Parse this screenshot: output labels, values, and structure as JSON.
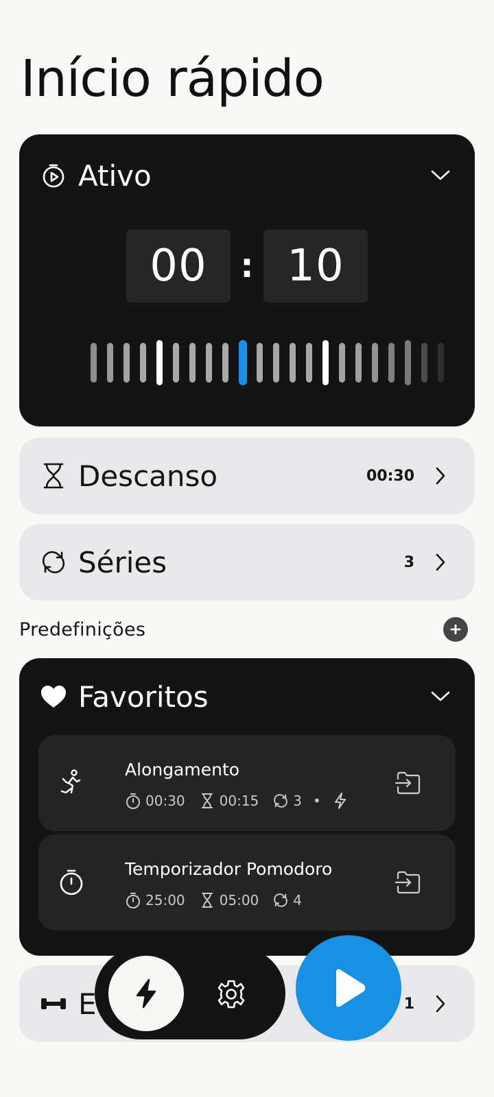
{
  "page": {
    "title": "Início rápido"
  },
  "active": {
    "label": "Ativo",
    "minutes": "00",
    "separator": ":",
    "seconds": "10"
  },
  "rest": {
    "label": "Descanso",
    "value": "00:30"
  },
  "sets": {
    "label": "Séries",
    "value": "3"
  },
  "presets_section": {
    "label": "Predefinições"
  },
  "favorites": {
    "label": "Favoritos",
    "items": [
      {
        "name": "Alongamento",
        "icon": "stretch-figure-icon",
        "work": "00:30",
        "rest": "00:15",
        "sets": "3",
        "dot": "•",
        "extra_icon": "lightning-icon"
      },
      {
        "name": "Temporizador Pomodoro",
        "icon": "stopwatch-icon",
        "work": "25:00",
        "rest": "05:00",
        "sets": "4"
      }
    ]
  },
  "bottom_card": {
    "label": "E",
    "value": "1"
  },
  "colors": {
    "accent": "#1890e4",
    "dark_card": "#141414",
    "light_card": "#e9e8ea",
    "background": "#f8f8f6"
  }
}
